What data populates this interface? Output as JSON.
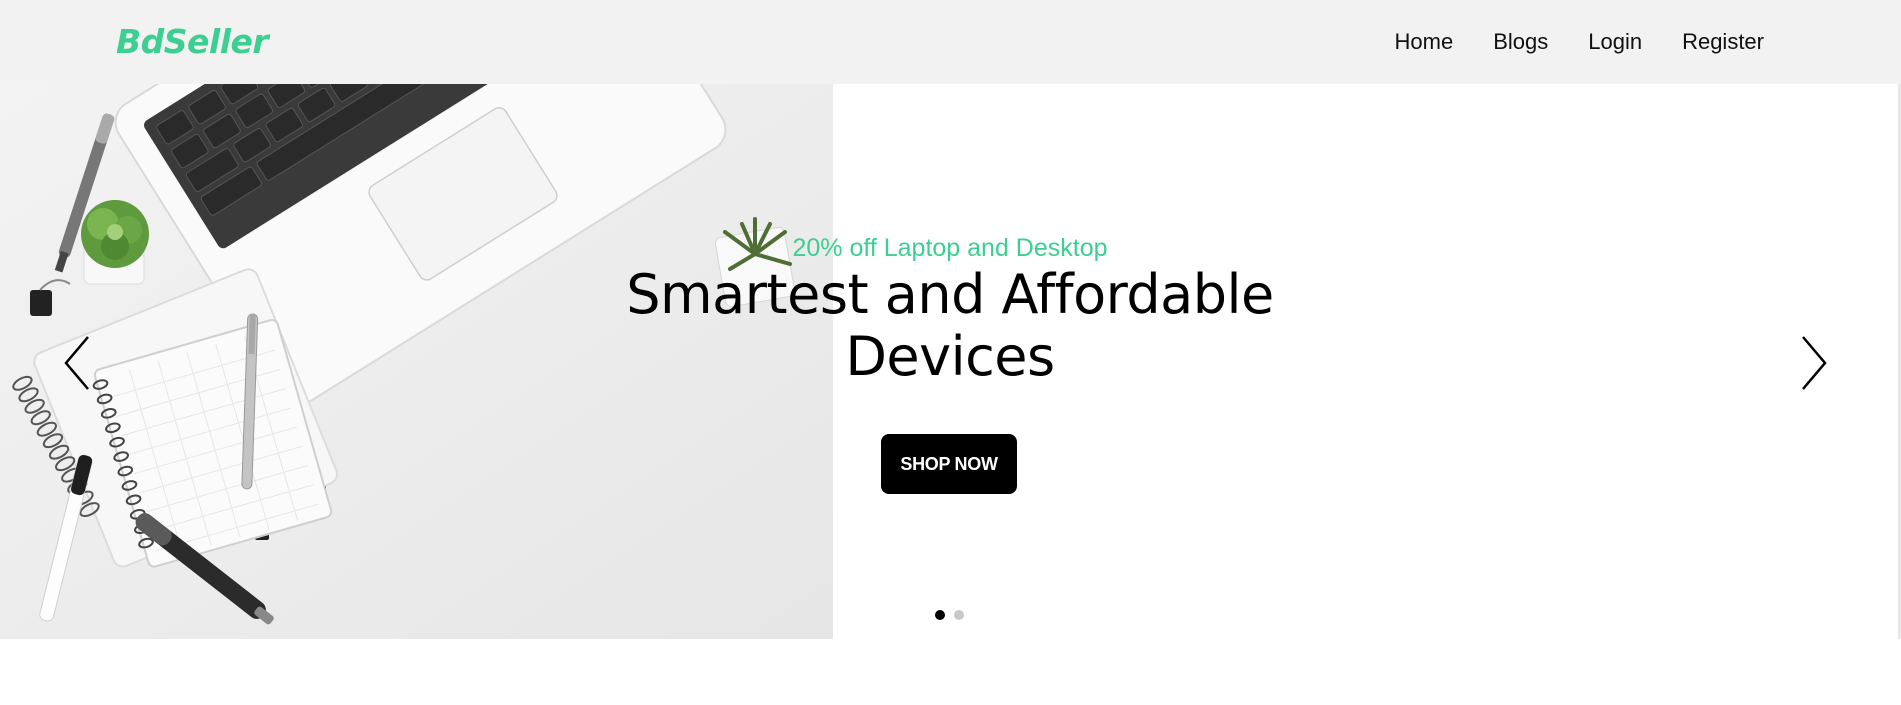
{
  "header": {
    "brand": "BdSeller",
    "nav": [
      {
        "label": "Home"
      },
      {
        "label": "Blogs"
      },
      {
        "label": "Login"
      },
      {
        "label": "Register"
      }
    ]
  },
  "hero": {
    "image": "laptop-desk-flatlay",
    "tagline": "20% off Laptop and Desktop",
    "title_line1": "Smartest and Affordable",
    "title_line2": "Devices",
    "cta_label": "SHOP NOW",
    "prev_icon": "chevron-left-icon",
    "next_icon": "chevron-right-icon",
    "slides_total": 2,
    "active_slide": 1
  },
  "colors": {
    "accent": "#3ccf91",
    "navbar_bg": "#f2f2f2",
    "button_bg": "#000000",
    "text": "#111111"
  }
}
